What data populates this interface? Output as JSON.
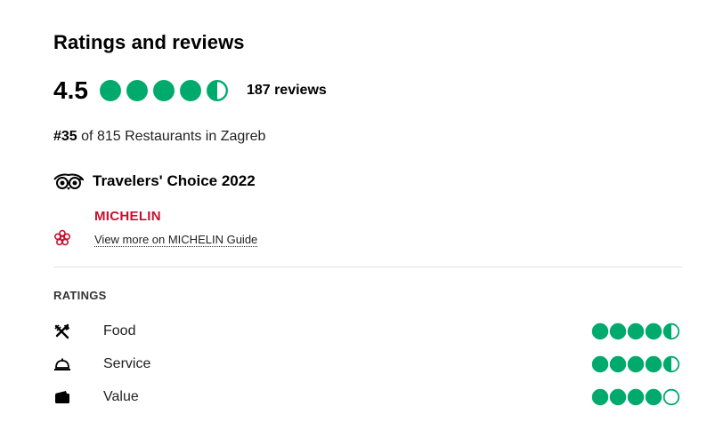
{
  "header": {
    "title": "Ratings and reviews"
  },
  "overall": {
    "score": "4.5",
    "rating_value": 4.5,
    "rating_max": 5,
    "review_count": "187 reviews"
  },
  "ranking": {
    "rank": "#35",
    "text": " of 815 Restaurants in Zagreb"
  },
  "award": {
    "icon": "travelers-choice-owl-icon",
    "label": "Travelers' Choice 2022"
  },
  "michelin": {
    "brand": "MICHELIN",
    "icon": "michelin-flower-icon",
    "link_text": "View more on MICHELIN Guide"
  },
  "ratings": {
    "heading": "RATINGS",
    "items": [
      {
        "label": "Food",
        "icon": "cutlery-icon",
        "value": 4.5
      },
      {
        "label": "Service",
        "icon": "service-bell-icon",
        "value": 4.5
      },
      {
        "label": "Value",
        "icon": "wallet-icon",
        "value": 4.0
      }
    ]
  },
  "colors": {
    "bubble": "#00aa6c",
    "michelin_red": "#c8102e"
  }
}
